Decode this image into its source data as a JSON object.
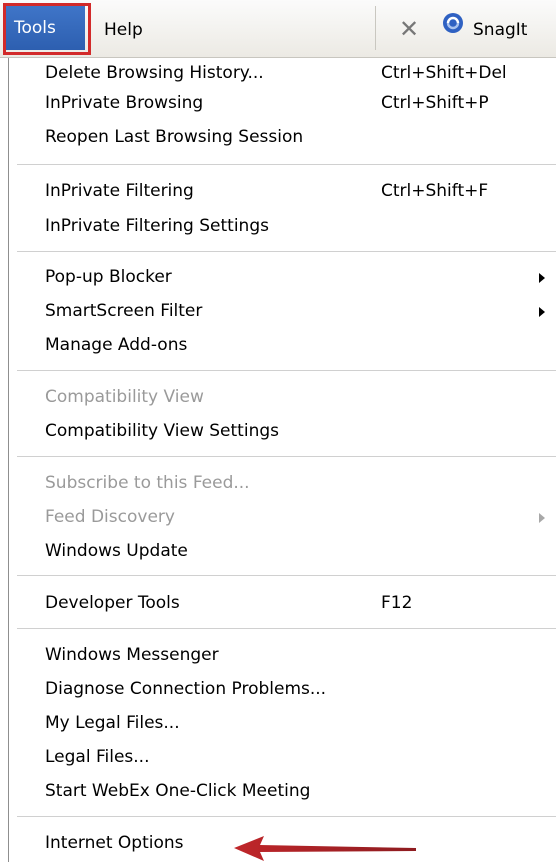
{
  "menubar": {
    "tools_label": "Tools",
    "help_label": "Help",
    "close_glyph": "✕",
    "snagit_label": "SnagIt",
    "highlight_color": "#d22a2a"
  },
  "menu": {
    "items": [
      {
        "label": "Delete Browsing History...",
        "shortcut": "Ctrl+Shift+Del"
      },
      {
        "label": "InPrivate Browsing",
        "shortcut": "Ctrl+Shift+P"
      },
      {
        "label": "Reopen Last Browsing Session",
        "shortcut": ""
      },
      {
        "label": "InPrivate Filtering",
        "shortcut": "Ctrl+Shift+F"
      },
      {
        "label": "InPrivate Filtering Settings",
        "shortcut": ""
      },
      {
        "label": "Pop-up Blocker",
        "submenu": true
      },
      {
        "label": "SmartScreen Filter",
        "submenu": true
      },
      {
        "label": "Manage Add-ons"
      },
      {
        "label": "Compatibility View",
        "disabled": true
      },
      {
        "label": "Compatibility View Settings"
      },
      {
        "label": "Subscribe to this Feed...",
        "disabled": true
      },
      {
        "label": "Feed Discovery",
        "disabled": true,
        "submenu": true
      },
      {
        "label": "Windows Update"
      },
      {
        "label": "Developer Tools",
        "shortcut": "F12"
      },
      {
        "label": "Windows Messenger"
      },
      {
        "label": "Diagnose Connection Problems..."
      },
      {
        "label": "My Legal Files..."
      },
      {
        "label": "Legal Files..."
      },
      {
        "label": "Start WebEx One-Click Meeting"
      },
      {
        "label": "Internet Options"
      }
    ]
  },
  "annotation": {
    "arrow_color": "#c0262a",
    "arrow_target": "Internet Options"
  }
}
